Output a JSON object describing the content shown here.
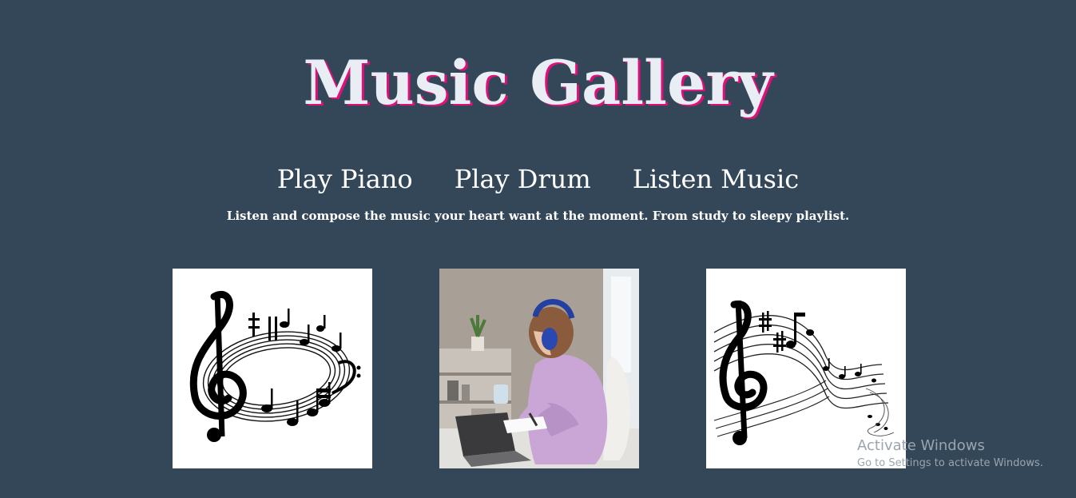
{
  "header": {
    "title": "Music Gallery"
  },
  "nav": {
    "items": [
      {
        "label": "Play Piano"
      },
      {
        "label": "Play Drum"
      },
      {
        "label": "Listen Music"
      }
    ]
  },
  "tagline": "Listen and compose the music your heart want at the moment. From study to sleepy playlist.",
  "gallery": {
    "images": [
      {
        "name": "treble-clef-swirl-image"
      },
      {
        "name": "girl-studying-headphones-image"
      },
      {
        "name": "music-staff-wave-image"
      }
    ]
  },
  "watermark": {
    "title": "Activate Windows",
    "subtitle": "Go to Settings to activate Windows."
  },
  "colors": {
    "background": "#344758",
    "title_text": "#e8eef4",
    "title_shadow": "#e0107a",
    "text": "#ffffff"
  }
}
